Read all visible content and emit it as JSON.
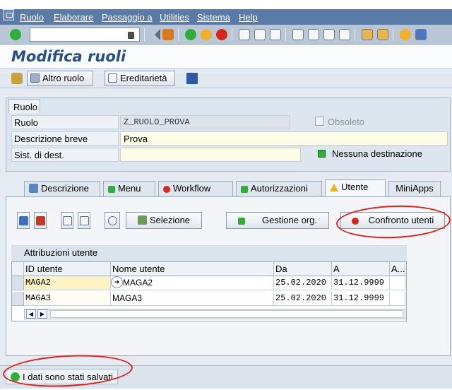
{
  "menu": {
    "items": [
      "Ruolo",
      "Elaborare",
      "Passaggio a",
      "Utilities",
      "Sistema",
      "Help"
    ]
  },
  "toolbar": {
    "command_value": ""
  },
  "title": "Modifica ruoli",
  "app_toolbar": {
    "other_role": "Altro ruolo",
    "inheritance": "Ereditarietà"
  },
  "header": {
    "group_tab": "Ruolo",
    "role_label": "Ruolo",
    "role_value": "Z_RUOLO_PROVA",
    "obsolete_label": "Obsoleto",
    "short_desc_label": "Descrizione breve",
    "short_desc_value": "Prova",
    "target_sys_label": "Sist. di dest.",
    "target_sys_value": "",
    "no_destination": "Nessuna destinazione"
  },
  "tabs": [
    "Descrizione",
    "Menu",
    "Workflow",
    "Autorizzazioni",
    "Utente",
    "MiniApps"
  ],
  "panel": {
    "selection": "Selezione",
    "org_mgmt": "Gestione org.",
    "user_compare": "Confronto utenti"
  },
  "table": {
    "title": "Attribuzioni utente",
    "columns": [
      "ID utente",
      "Nome utente",
      "Da",
      "A",
      "A..."
    ],
    "rows": [
      [
        "MAGA2",
        "MAGA2",
        "25.02.2020",
        "31.12.9999"
      ],
      [
        "MAGA3",
        "MAGA3",
        "25.02.2020",
        "31.12.9999"
      ]
    ]
  },
  "status": {
    "message": "I dati sono stati salvati"
  },
  "colors": {
    "menu_bg": "#5a7aa8",
    "title": "#2a4f86",
    "ok_green": "#2fae3a",
    "stop_red": "#d9261c",
    "annotation": "#e0201b"
  }
}
